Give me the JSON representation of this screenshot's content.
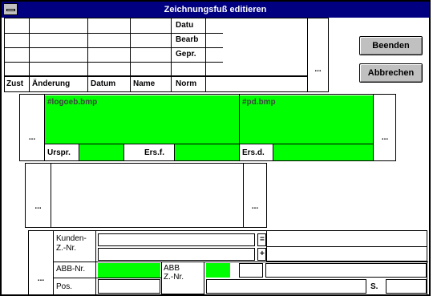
{
  "window": {
    "title": "Zeichnungsfuß editieren"
  },
  "revision_table": {
    "headers": [
      "Zust",
      "Änderung",
      "Datum",
      "Name",
      "Norm"
    ],
    "side_labels": [
      "Datu",
      "Bearb",
      "Gepr."
    ],
    "more_button": "..."
  },
  "buttons": {
    "close": "Beenden",
    "cancel": "Abbrechen"
  },
  "logos": {
    "left_browse": "...",
    "left_image": "#logoeb.bmp",
    "right_image": "#pd.bmp",
    "right_browse": "...",
    "labels": [
      "Urspr.",
      "Ers.f.",
      "Ers.d."
    ]
  },
  "text_area": {
    "left_browse": "...",
    "right_browse": "..."
  },
  "bottom": {
    "browse": "...",
    "customer_label": "Kunden-\nZ.-Nr.",
    "eq_sign": "=",
    "plus_sign": "+",
    "abb_nr_label": "ABB-Nr.",
    "abb_znr_label": "ABB\nZ.-Nr.",
    "pos_label": "Pos.",
    "s_label": "S."
  },
  "colors": {
    "title_bar": "#000080",
    "field_green": "#00ff00",
    "button_face": "#c0c0c0"
  }
}
